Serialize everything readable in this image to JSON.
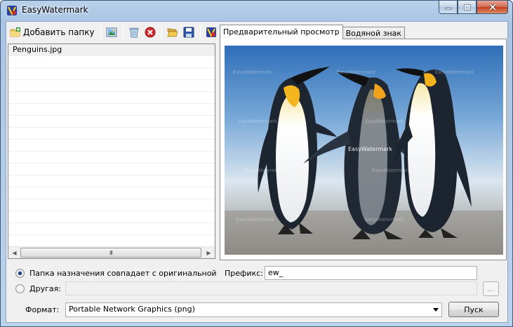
{
  "window": {
    "title": "EasyWatermark"
  },
  "toolbar": {
    "add_folder_label": "Добавить папку",
    "buttons": [
      "add-image",
      "delete",
      "remove",
      "open",
      "save",
      "settings"
    ]
  },
  "file_list": {
    "items": [
      {
        "name": "Penguins.jpg",
        "selected": true
      }
    ],
    "scroll_thumb_glyph": "III"
  },
  "tabs": [
    {
      "label": "Предварительный просмотр",
      "active": true
    },
    {
      "label": "Водяной знак",
      "active": false
    }
  ],
  "preview": {
    "watermark_text": "EasyWatermark"
  },
  "destination": {
    "same_as_original_label": "Папка назначения совпадает с оригинальной",
    "same_as_original_checked": true,
    "other_label": "Другая:",
    "other_checked": false,
    "other_path_value": "",
    "browse_label": "..."
  },
  "prefix": {
    "label": "Префикс:",
    "value": "ew_"
  },
  "format": {
    "label": "Формат:",
    "selected": "Portable Network Graphics (png)"
  },
  "start_button_label": "Пуск",
  "colors": {
    "accent": "#1a3e78",
    "sky_top": "#3f7bc0",
    "sky_bottom": "#e8eef3",
    "sand": "#8f8c86"
  }
}
